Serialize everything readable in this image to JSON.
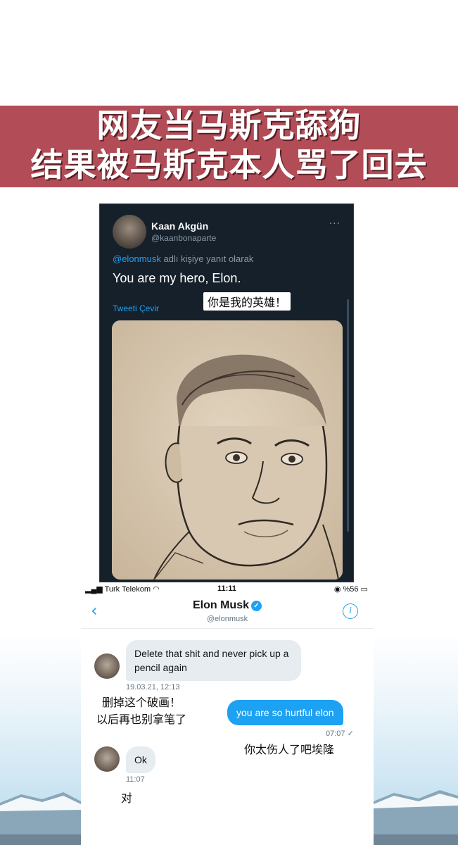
{
  "banner": {
    "line1": "网友当马斯克舔狗",
    "line2": "结果被马斯克本人骂了回去"
  },
  "tweet": {
    "author_name": "Kaan Akgün",
    "author_handle": "@kaanbonaparte",
    "more_icon": "ellipsis-icon",
    "reply_mention": "@elonmusk",
    "reply_suffix": " adlı kişiye yanıt olarak",
    "text": "You are my hero, Elon.",
    "translate_link": "Tweeti Çevir",
    "caption": "你是我的英雄！"
  },
  "phone": {
    "status": {
      "carrier": "Turk Telekom",
      "time": "11:11",
      "battery": "%56"
    },
    "header": {
      "name": "Elon Musk",
      "handle": "@elonmusk",
      "back_icon": "chevron-left-icon",
      "info_icon": "info-icon"
    },
    "messages": [
      {
        "from": "elonmusk",
        "text": "Delete that shit and never pick up a pencil again",
        "time": "19.03.21, 12:13",
        "caption": "删掉这个破画！\n以后再也别拿笔了"
      },
      {
        "from": "me",
        "text": "you are so hurtful elon",
        "time": "07:07 ✓",
        "caption": "你太伤人了吧埃隆"
      },
      {
        "from": "elonmusk",
        "text": "Ok",
        "time": "11:07",
        "caption": "对"
      }
    ]
  },
  "colors": {
    "banner_bg": "#b24d57",
    "twitter_blue": "#1da1f2",
    "dark_bg": "#15202b",
    "bubble_in": "#e6ecf0"
  }
}
